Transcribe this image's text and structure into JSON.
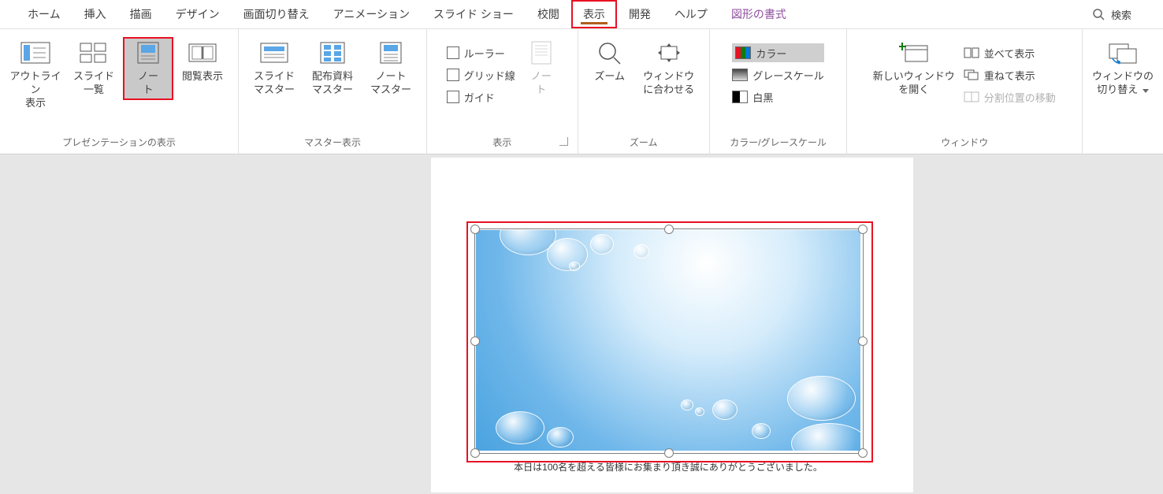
{
  "tabs": {
    "home": "ホーム",
    "insert": "挿入",
    "draw": "描画",
    "design": "デザイン",
    "transition": "画面切り替え",
    "animation": "アニメーション",
    "slideshow": "スライド ショー",
    "review": "校閲",
    "view": "表示",
    "developer": "開発",
    "help": "ヘルプ",
    "shape_format": "図形の書式"
  },
  "search_placeholder": "検索",
  "groups": {
    "presentation_views": {
      "label": "プレゼンテーションの表示",
      "outline": "アウトライン\n表示",
      "slide_sorter": "スライド\n一覧",
      "notes": "ノー\nト",
      "reading": "閲覧表示"
    },
    "master_views": {
      "label": "マスター表示",
      "slide_master": "スライド\nマスター",
      "handout_master": "配布資料\nマスター",
      "notes_master": "ノート\nマスター"
    },
    "show": {
      "label": "表示",
      "ruler": "ルーラー",
      "gridlines": "グリッド線",
      "guides": "ガイド",
      "notes_btn": "ノー\nト"
    },
    "zoom": {
      "label": "ズーム",
      "zoom": "ズーム",
      "fit": "ウィンドウ\nに合わせる"
    },
    "color": {
      "label": "カラー/グレースケール",
      "color": "カラー",
      "grayscale": "グレースケール",
      "bw": "白黒"
    },
    "window": {
      "label": "ウィンドウ",
      "new_window": "新しいウィンドウ\nを開く",
      "arrange": "並べて表示",
      "cascade": "重ねて表示",
      "move_split": "分割位置の移動",
      "switch": "ウィンドウの\n切り替え"
    }
  },
  "slide": {
    "caption": "本日は100名を超える皆様にお集まり頂き誠にありがとうございました。"
  }
}
